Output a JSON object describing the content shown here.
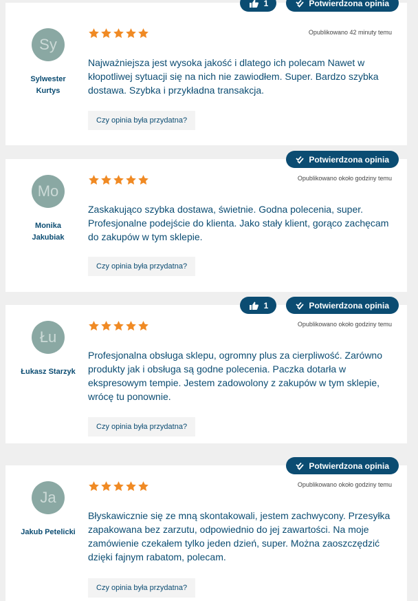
{
  "colors": {
    "brand": "#0b4c72",
    "star": "#f08a24",
    "avatar_bg": "#8aa8a3",
    "card_bg": "#ffffff",
    "page_bg": "#efefef"
  },
  "labels": {
    "verified": "Potwierdzona opinia",
    "helpful_question": "Czy opinia była przydatna?",
    "like_icon": "thumbs-up-icon",
    "verified_icon": "verified-check-icon",
    "star_icon": "star-icon"
  },
  "reviews": [
    {
      "initials": "Sy",
      "author": "Sylwester Kurtys",
      "rating": 5,
      "likes": "1",
      "date": "Opublikowano 42 minuty temu",
      "text": "Najważniejsza jest wysoka jakość i dlatego ich polecam Nawet w kłopotliwej sytuacji się na nich nie zawiodłem. Super. Bardzo szybka dostawa. Szybka i przykładna transakcja."
    },
    {
      "initials": "Mo",
      "author": "Monika Jakubiak",
      "rating": 5,
      "likes": null,
      "date": "Opublikowano około godziny temu",
      "text": "Zaskakująco szybka dostawa, świetnie. Godna polecenia, super. Profesjonalne podejście do klienta. Jako stały klient, gorąco zachęcam do zakupów w tym sklepie."
    },
    {
      "initials": "Łu",
      "author": "Łukasz Starzyk",
      "rating": 5,
      "likes": "1",
      "date": "Opublikowano około godziny temu",
      "text": "Profesjonalna obsługa sklepu, ogromny plus za cierpliwość. Zarówno produkty jak i obsługa są godne polecenia. Paczka dotarła w ekspresowym tempie. Jestem zadowolony z zakupów w tym sklepie, wrócę tu ponownie."
    },
    {
      "initials": "Ja",
      "author": "Jakub Petelicki",
      "rating": 5,
      "likes": null,
      "date": "Opublikowano około godziny temu",
      "text": "Błyskawicznie się ze mną skontakowali, jestem zachwycony. Przesyłka zapakowana bez zarzutu, odpowiednio do jej zawartości. Na moje zamówienie czekałem tylko jeden dzień, super. Można zaoszczędzić dzięki fajnym rabatom, polecam."
    }
  ]
}
